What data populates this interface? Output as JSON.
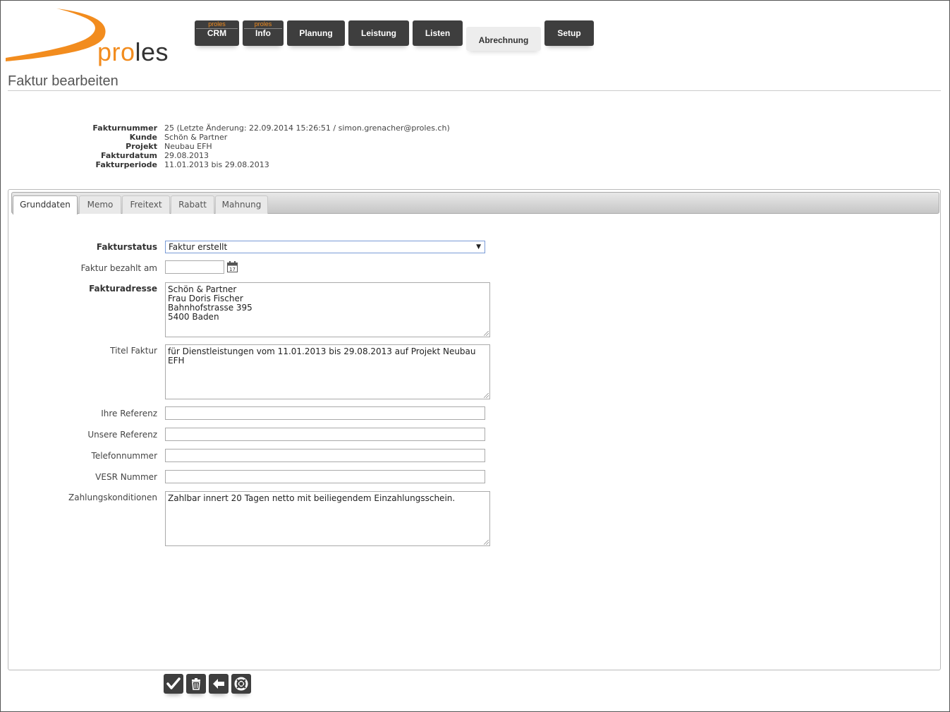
{
  "logo": {
    "text_pro": "pro",
    "text_les": "les"
  },
  "nav": {
    "crm": {
      "sup": "proles",
      "label": "CRM"
    },
    "info": {
      "sup": "proles",
      "label": "Info"
    },
    "planung": {
      "label": "Planung"
    },
    "leistung": {
      "label": "Leistung"
    },
    "listen": {
      "label": "Listen"
    },
    "abrechnung": {
      "label": "Abrechnung",
      "active": true
    },
    "setup": {
      "label": "Setup"
    }
  },
  "page_title": "Faktur bearbeiten",
  "meta": {
    "fakturnummer": {
      "label": "Fakturnummer",
      "value": "25 (Letzte Änderung: 22.09.2014 15:26:51 / simon.grenacher@proles.ch)"
    },
    "kunde": {
      "label": "Kunde",
      "value": "Schön & Partner"
    },
    "projekt": {
      "label": "Projekt",
      "value": "Neubau EFH"
    },
    "fakturdatum": {
      "label": "Fakturdatum",
      "value": "29.08.2013"
    },
    "fakturperiode": {
      "label": "Fakturperiode",
      "value": "11.01.2013 bis 29.08.2013"
    }
  },
  "tabs": [
    {
      "label": "Grunddaten",
      "active": true
    },
    {
      "label": "Memo"
    },
    {
      "label": "Freitext"
    },
    {
      "label": "Rabatt"
    },
    {
      "label": "Mahnung"
    }
  ],
  "form": {
    "fakturstatus": {
      "label": "Fakturstatus",
      "value": "Faktur erstellt"
    },
    "bezahlt_am": {
      "label": "Faktur bezahlt am",
      "value": ""
    },
    "fakturadresse": {
      "label": "Fakturadresse",
      "value": "Schön & Partner\nFrau Doris Fischer\nBahnhofstrasse 395\n5400 Baden"
    },
    "titel": {
      "label": "Titel Faktur",
      "value": "für Dienstleistungen vom 11.01.2013 bis 29.08.2013 auf Projekt Neubau EFH"
    },
    "ihre_referenz": {
      "label": "Ihre Referenz",
      "value": ""
    },
    "unsere_referenz": {
      "label": "Unsere Referenz",
      "value": ""
    },
    "telefon": {
      "label": "Telefonnummer",
      "value": ""
    },
    "vesr": {
      "label": "VESR Nummer",
      "value": ""
    },
    "zahlung": {
      "label": "Zahlungskonditionen",
      "value": "Zahlbar innert 20 Tagen netto mit beiliegendem Einzahlungsschein."
    }
  },
  "calendar_icon": {
    "day": "17"
  },
  "actions": [
    "check-icon",
    "trash-icon",
    "back-arrow-icon",
    "help-lifebuoy-icon"
  ],
  "colors": {
    "brand_orange": "#f28c1e",
    "nav_dark": "#3e3e3e"
  }
}
